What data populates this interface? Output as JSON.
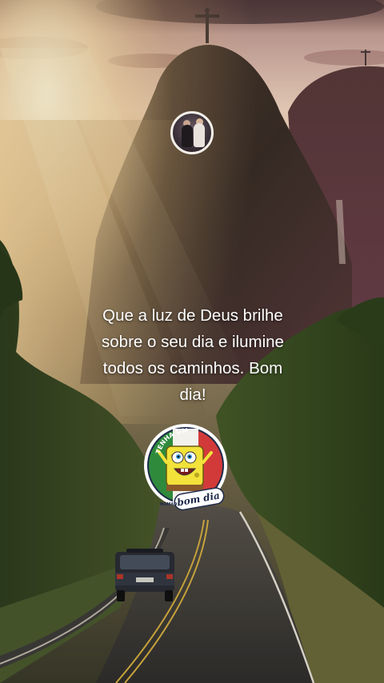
{
  "caption": {
    "lines": [
      "Que a luz de Deus brilhe",
      "sobre o seu dia e ilumine",
      "todos os caminhos. Bom",
      "dia!"
    ]
  },
  "sticker": {
    "top_text": "TENHA UM",
    "bottom_text": "bom dia",
    "small_text": "NOMAD"
  },
  "colors": {
    "sky_glow": "#f6dcb0",
    "mountain": "#3d3129",
    "road": "#3b3a38",
    "foliage": "#3f5a2a",
    "text": "#ffffff"
  }
}
